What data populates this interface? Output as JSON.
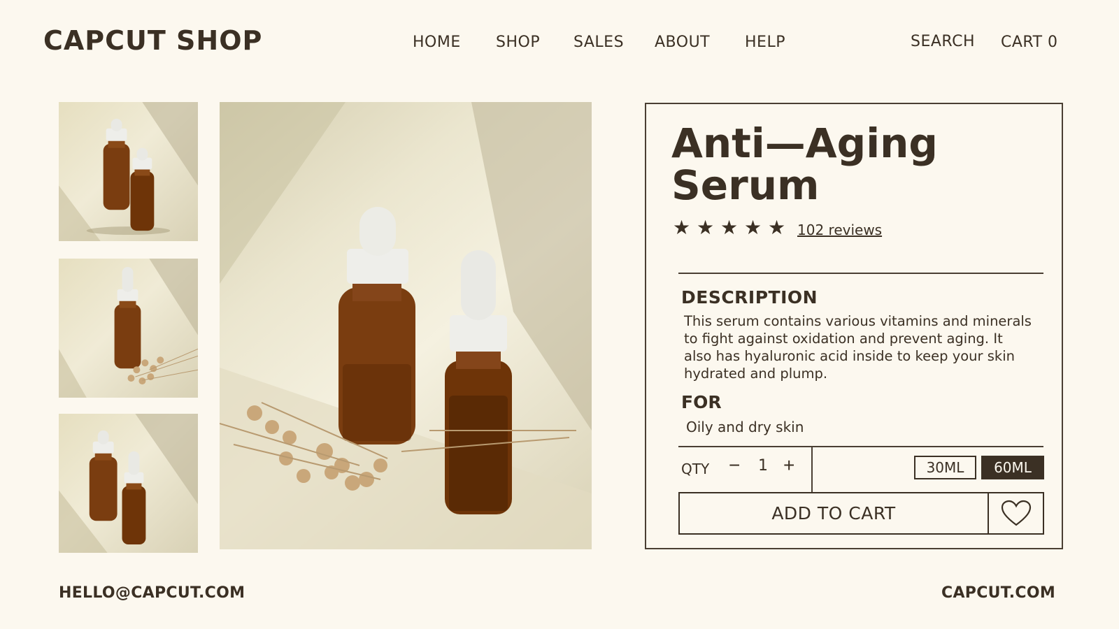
{
  "header": {
    "logo": "CAPCUT SHOP",
    "nav": [
      "HOME",
      "SHOP",
      "SALES",
      "ABOUT",
      "HELP"
    ],
    "search": "SEARCH",
    "cart": "CART 0"
  },
  "product": {
    "title_line1": "Anti—Aging",
    "title_line2": "Serum",
    "rating": 5,
    "star_glyph": "★",
    "reviews": "102 reviews",
    "description_heading": "DESCRIPTION",
    "description": "This serum contains various vitamins and minerals to fight against oxidation and prevent aging. It also has hyaluronic acid inside to keep your skin hydrated and plump.",
    "for_heading": "FOR",
    "for_text": "Oily and dry skin",
    "qty_label": "QTY",
    "qty_minus": "−",
    "qty_value": "1",
    "qty_plus": "+",
    "sizes": [
      "30ML",
      "60ML"
    ],
    "selected_size": "60ML",
    "add_to_cart": "ADD TO CART",
    "wishlist_icon": "heart-icon"
  },
  "footer": {
    "email": "HELLO@CAPCUT.COM",
    "site": "CAPCUT.COM"
  },
  "colors": {
    "background": "#fcf8ef",
    "text": "#3b3024",
    "amber_bottle": "#7a3d10"
  }
}
